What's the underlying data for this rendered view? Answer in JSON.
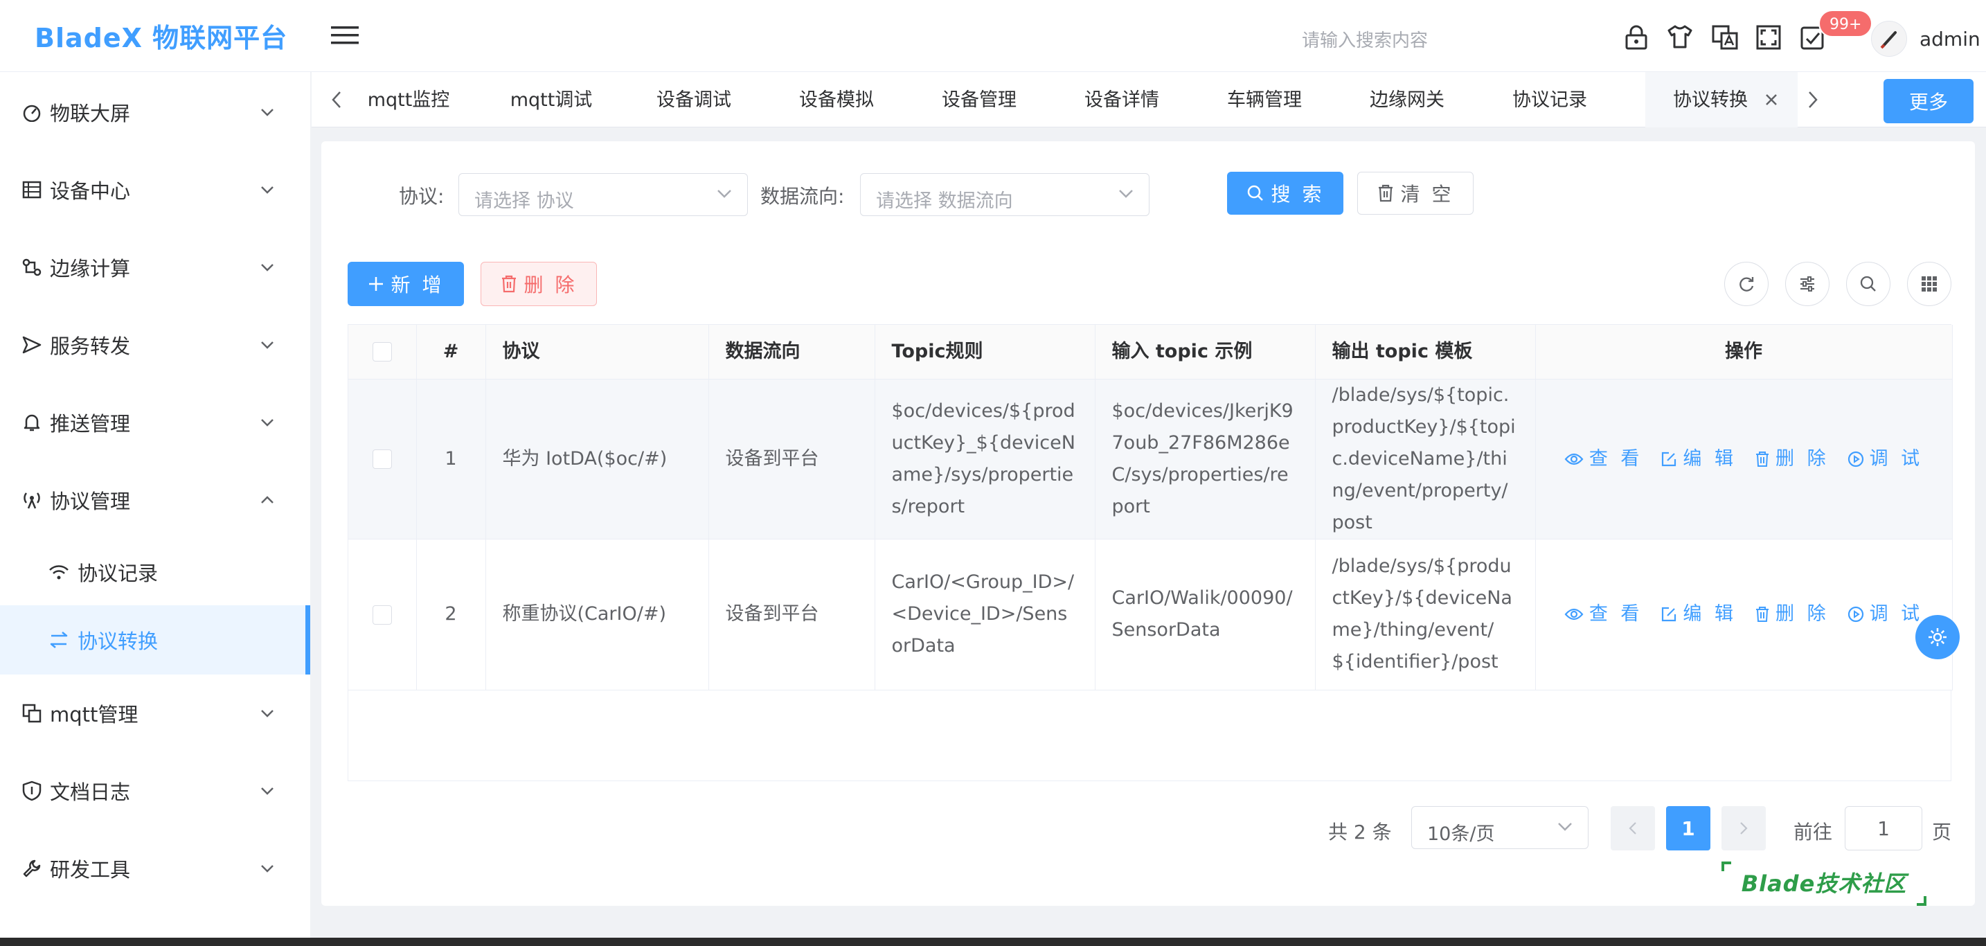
{
  "header": {
    "brand": "BladeX 物联网平台",
    "search_placeholder": "请输入搜索内容",
    "notification_badge": "99+",
    "username": "admin",
    "icons": [
      "lock-icon",
      "theme-shirt-icon",
      "language-icon",
      "fullscreen-icon",
      "notification-icon"
    ]
  },
  "sidebar": {
    "items": [
      {
        "label": "物联大屏",
        "icon": "dashboard-icon",
        "expanded": false
      },
      {
        "label": "设备中心",
        "icon": "device-list-icon",
        "expanded": false
      },
      {
        "label": "边缘计算",
        "icon": "edge-compute-icon",
        "expanded": false
      },
      {
        "label": "服务转发",
        "icon": "forward-icon",
        "expanded": false
      },
      {
        "label": "推送管理",
        "icon": "bell-icon",
        "expanded": false
      },
      {
        "label": "协议管理",
        "icon": "antenna-icon",
        "expanded": true
      },
      {
        "label": "mqtt管理",
        "icon": "mqtt-icon",
        "expanded": false
      },
      {
        "label": "文档日志",
        "icon": "shield-icon",
        "expanded": false
      },
      {
        "label": "研发工具",
        "icon": "wrench-icon",
        "expanded": false
      }
    ],
    "sub_items": [
      {
        "label": "协议记录",
        "icon": "wifi-icon",
        "active": false
      },
      {
        "label": "协议转换",
        "icon": "transfer-icon",
        "active": true
      }
    ]
  },
  "tabs": {
    "items": [
      "mqtt监控",
      "mqtt调试",
      "设备调试",
      "设备模拟",
      "设备管理",
      "设备详情",
      "车辆管理",
      "边缘网关",
      "协议记录",
      "协议转换"
    ],
    "active": "协议转换",
    "more_label": "更多"
  },
  "filter": {
    "protocol_label": "协议:",
    "protocol_placeholder": "请选择 协议",
    "flow_label": "数据流向:",
    "flow_placeholder": "请选择 数据流向",
    "search_label": "搜 索",
    "clear_label": "清 空"
  },
  "toolbar": {
    "add_label": "新 增",
    "delete_label": "删 除"
  },
  "table": {
    "columns": [
      "#",
      "协议",
      "数据流向",
      "Topic规则",
      "输入 topic 示例",
      "输出 topic 模板",
      "操作"
    ],
    "rows": [
      {
        "index": "1",
        "protocol": "华为 IotDA($oc/#)",
        "flow": "设备到平台",
        "topic_rule": "$oc/devices/${productKey}_${deviceName}/sys/properties/report",
        "input_example": "$oc/devices/JkerjK97oub_27F86M286eC/sys/properties/report",
        "output_template": "/blade/sys/${topic.productKey}/${topic.deviceName}/thing/event/property/post"
      },
      {
        "index": "2",
        "protocol": "称重协议(CarIO/#)",
        "flow": "设备到平台",
        "topic_rule": "CarIO/<Group_ID>/<Device_ID>/SensorData",
        "input_example": "CarIO/Walik/00090/SensorData",
        "output_template": "/blade/sys/${productKey}/${deviceName}/thing/event/${identifier}/post"
      }
    ],
    "actions": [
      "查 看",
      "编 辑",
      "删 除",
      "调 试"
    ]
  },
  "pagination": {
    "total_text": "共 2 条",
    "page_size": "10条/页",
    "current_page": "1",
    "goto_label": "前往",
    "goto_value": "1",
    "page_suffix": "页"
  },
  "watermark": "Blade技术社区",
  "colors": {
    "primary": "#409eff",
    "danger": "#f56c6c",
    "watermark_green": "#2e9d49"
  }
}
